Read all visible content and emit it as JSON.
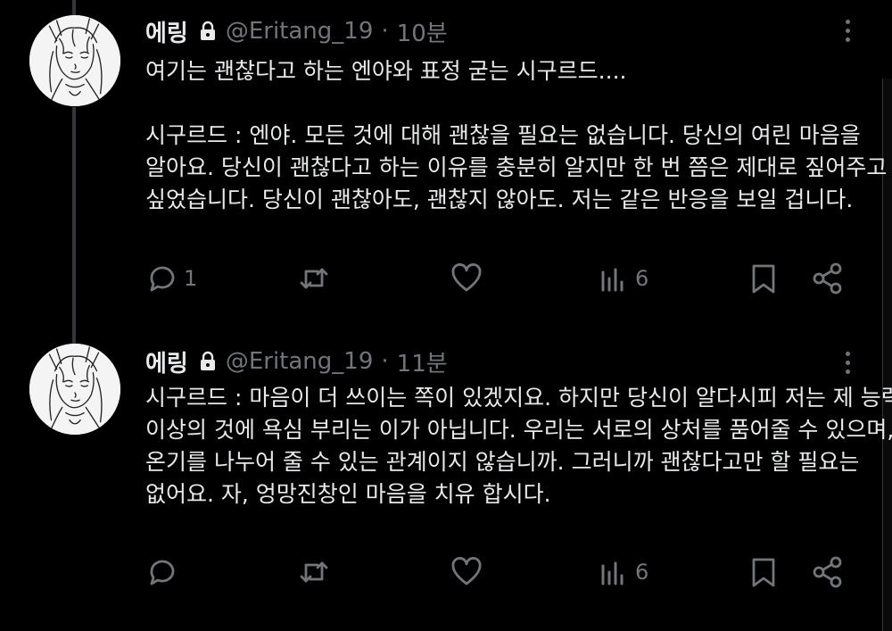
{
  "tweets": [
    {
      "name": "에링",
      "handle": "@Eritang_19",
      "separator": "·",
      "time": "10분",
      "lines": [
        "여기는 괜찮다고 하는 엔야와 표정 굳는 시구르드....",
        "",
        "시구르드 : 엔야. 모든 것에 대해 괜찮을 필요는 없습니다. 당신의 여린 마음을",
        "알아요. 당신이 괜찮다고 하는 이유를 충분히 알지만 한 번 쯤은 제대로 짚어주고",
        "싶었습니다. 당신이 괜찮아도, 괜찮지 않아도. 저는 같은 반응을 보일 겁니다."
      ],
      "reply_count": "1",
      "retweet_count": "",
      "like_count": "",
      "view_count": "6"
    },
    {
      "name": "에링",
      "handle": "@Eritang_19",
      "separator": "·",
      "time": "11분",
      "lines": [
        "시구르드 : 마음이 더 쓰이는 쪽이 있겠지요. 하지만 당신이 알다시피 저는 제 능력",
        "이상의 것에 욕심 부리는 이가 아닙니다. 우리는 서로의 상처를 품어줄 수 있으며,",
        "온기를 나누어 줄 수 있는 관계이지 않습니까. 그러니까 괜찮다고만 할 필요는",
        "없어요. 자, 엉망진창인 마음을 치유 합시다."
      ],
      "reply_count": "",
      "retweet_count": "",
      "like_count": "",
      "view_count": "6"
    }
  ],
  "icons": {
    "lock": "lock-icon",
    "more": "more-dots-icon",
    "reply": "reply-icon",
    "retweet": "retweet-icon",
    "like": "heart-icon",
    "views": "views-chart-icon",
    "bookmark": "bookmark-icon",
    "share": "share-icon"
  },
  "colors": {
    "background": "#000000",
    "text": "#e7e9ea",
    "muted": "#71767b",
    "thread_line": "#333639"
  }
}
